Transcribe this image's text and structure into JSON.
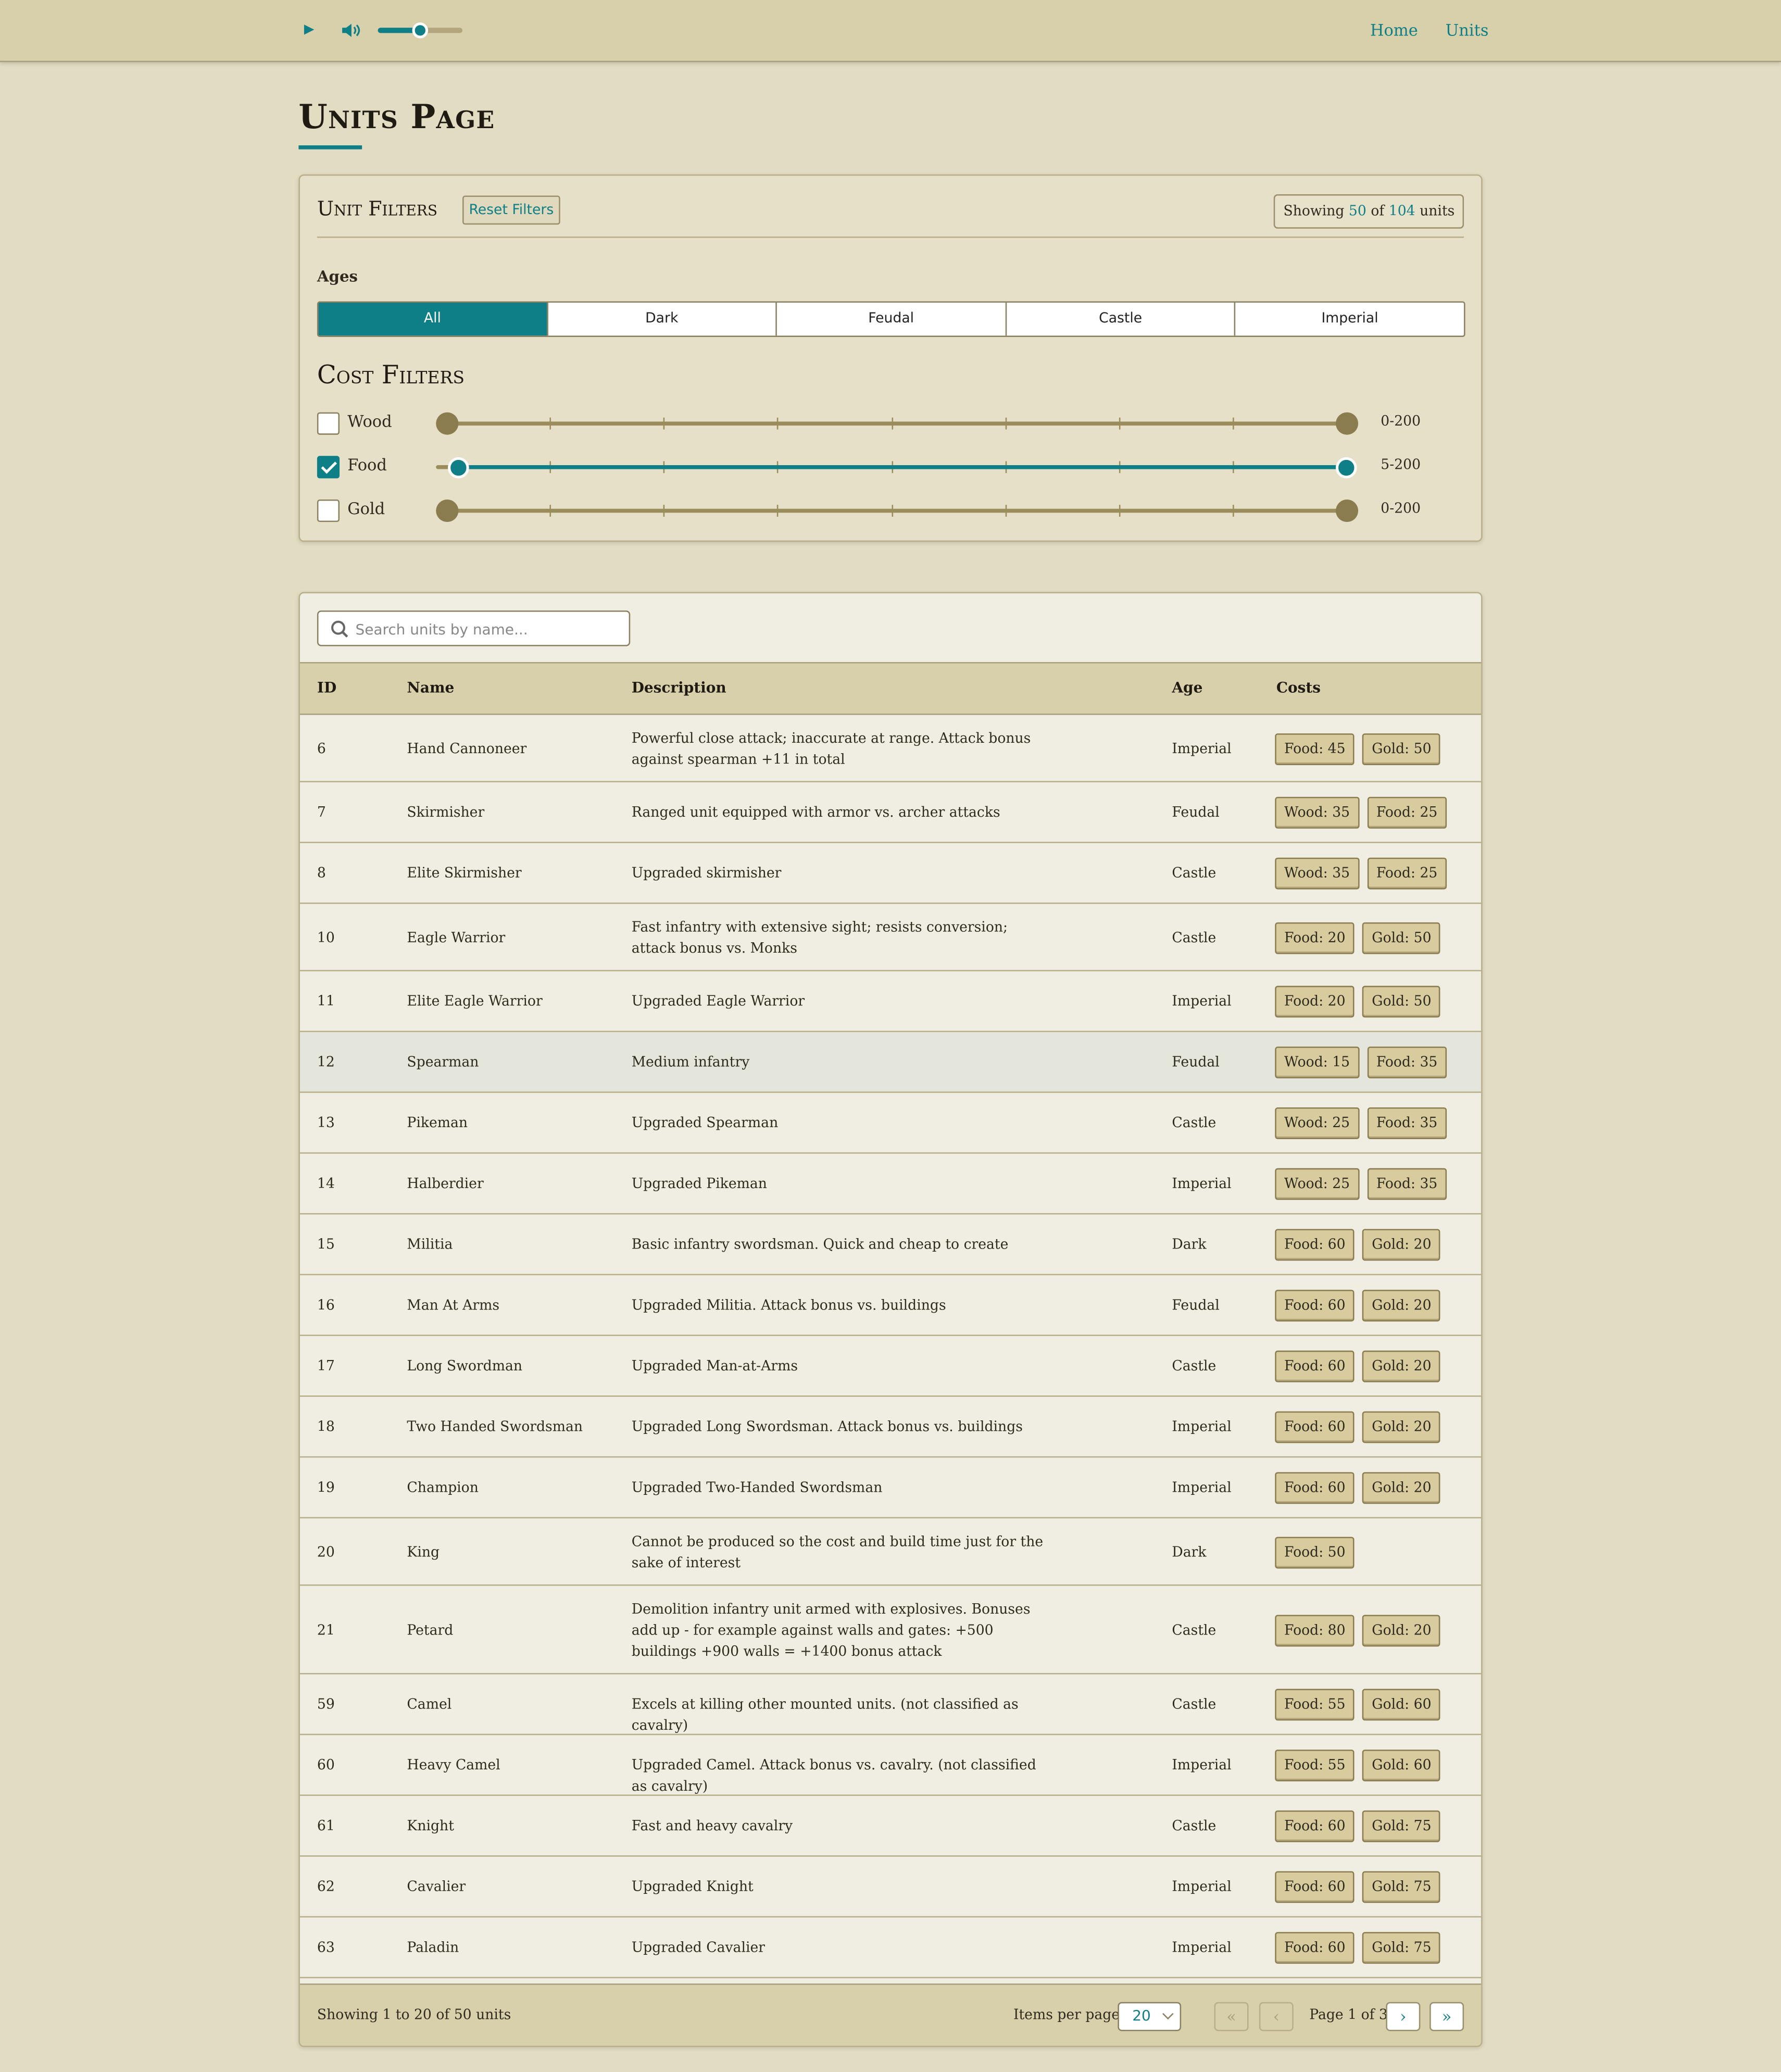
{
  "player": {
    "play_icon": "play-icon",
    "volume_icon": "speaker-icon",
    "volume_level": 0.5
  },
  "nav": {
    "home": "Home",
    "units": "Units"
  },
  "page_title": "Units Page",
  "filters": {
    "title": "Unit Filters",
    "reset_label": "Reset Filters",
    "showing": {
      "prefix": "Showing",
      "shown": "50",
      "of": "of",
      "total": "104",
      "suffix": "units"
    },
    "ages_label": "Ages",
    "ages": [
      "All",
      "Dark",
      "Feudal",
      "Castle",
      "Imperial"
    ],
    "active_age": "All",
    "cost_title": "Cost Filters",
    "costs": [
      {
        "label": "Wood",
        "checked": false,
        "min": 0,
        "max": 200,
        "range_text": "0-200"
      },
      {
        "label": "Food",
        "checked": true,
        "min": 5,
        "max": 200,
        "range_text": "5-200"
      },
      {
        "label": "Gold",
        "checked": false,
        "min": 0,
        "max": 200,
        "range_text": "0-200"
      }
    ]
  },
  "table": {
    "search_placeholder": "Search units by name...",
    "search_icon": "search-icon",
    "columns": [
      "ID",
      "Name",
      "Description",
      "Age",
      "Costs"
    ],
    "rows": [
      {
        "id": "6",
        "name": "Hand Cannoneer",
        "desc": "Powerful close attack; inaccurate at range. Attack bonus against spearman +11 in total",
        "age": "Imperial",
        "costs": [
          "Food: 45",
          "Gold: 50"
        ]
      },
      {
        "id": "7",
        "name": "Skirmisher",
        "desc": "Ranged unit equipped with armor vs. archer attacks",
        "age": "Feudal",
        "costs": [
          "Wood: 35",
          "Food: 25"
        ]
      },
      {
        "id": "8",
        "name": "Elite Skirmisher",
        "desc": "Upgraded skirmisher",
        "age": "Castle",
        "costs": [
          "Wood: 35",
          "Food: 25"
        ]
      },
      {
        "id": "10",
        "name": "Eagle Warrior",
        "desc": "Fast infantry with extensive sight; resists conversion; attack bonus vs. Monks",
        "age": "Castle",
        "costs": [
          "Food: 20",
          "Gold: 50"
        ]
      },
      {
        "id": "11",
        "name": "Elite Eagle Warrior",
        "desc": "Upgraded Eagle Warrior",
        "age": "Imperial",
        "costs": [
          "Food: 20",
          "Gold: 50"
        ]
      },
      {
        "id": "12",
        "name": "Spearman",
        "desc": "Medium infantry",
        "age": "Feudal",
        "costs": [
          "Wood: 15",
          "Food: 35"
        ]
      },
      {
        "id": "13",
        "name": "Pikeman",
        "desc": "Upgraded Spearman",
        "age": "Castle",
        "costs": [
          "Wood: 25",
          "Food: 35"
        ]
      },
      {
        "id": "14",
        "name": "Halberdier",
        "desc": "Upgraded Pikeman",
        "age": "Imperial",
        "costs": [
          "Wood: 25",
          "Food: 35"
        ]
      },
      {
        "id": "15",
        "name": "Militia",
        "desc": "Basic infantry swordsman. Quick and cheap to create",
        "age": "Dark",
        "costs": [
          "Food: 60",
          "Gold: 20"
        ]
      },
      {
        "id": "16",
        "name": "Man At Arms",
        "desc": "Upgraded Militia. Attack bonus vs. buildings",
        "age": "Feudal",
        "costs": [
          "Food: 60",
          "Gold: 20"
        ]
      },
      {
        "id": "17",
        "name": "Long Swordman",
        "desc": "Upgraded Man-at-Arms",
        "age": "Castle",
        "costs": [
          "Food: 60",
          "Gold: 20"
        ]
      },
      {
        "id": "18",
        "name": "Two Handed Swordsman",
        "desc": "Upgraded Long Swordsman. Attack bonus vs. buildings",
        "age": "Imperial",
        "costs": [
          "Food: 60",
          "Gold: 20"
        ]
      },
      {
        "id": "19",
        "name": "Champion",
        "desc": "Upgraded Two-Handed Swordsman",
        "age": "Imperial",
        "costs": [
          "Food: 60",
          "Gold: 20"
        ]
      },
      {
        "id": "20",
        "name": "King",
        "desc": "Cannot be produced so the cost and build time just for the sake of interest",
        "age": "Dark",
        "costs": [
          "Food: 50"
        ]
      },
      {
        "id": "21",
        "name": "Petard",
        "desc": "Demolition infantry unit armed with explosives. Bonuses add up - for example against walls and gates: +500 buildings +900 walls = +1400 bonus attack",
        "age": "Castle",
        "costs": [
          "Food: 80",
          "Gold: 20"
        ]
      },
      {
        "id": "59",
        "name": "Camel",
        "desc": "Excels at killing other mounted units. (not classified as cavalry)",
        "age": "Castle",
        "costs": [
          "Food: 55",
          "Gold: 60"
        ]
      },
      {
        "id": "60",
        "name": "Heavy Camel",
        "desc": "Upgraded Camel. Attack bonus vs. cavalry. (not classified as cavalry)",
        "age": "Imperial",
        "costs": [
          "Food: 55",
          "Gold: 60"
        ]
      },
      {
        "id": "61",
        "name": "Knight",
        "desc": "Fast and heavy cavalry",
        "age": "Castle",
        "costs": [
          "Food: 60",
          "Gold: 75"
        ]
      },
      {
        "id": "62",
        "name": "Cavalier",
        "desc": "Upgraded Knight",
        "age": "Imperial",
        "costs": [
          "Food: 60",
          "Gold: 75"
        ]
      },
      {
        "id": "63",
        "name": "Paladin",
        "desc": "Upgraded Cavalier",
        "age": "Imperial",
        "costs": [
          "Food: 60",
          "Gold: 75"
        ]
      }
    ],
    "hovered_row": "12"
  },
  "footer": {
    "showing_text": "Showing 1 to 20 of 50 units",
    "items_per_page_label": "Items per page:",
    "items_per_page": "20",
    "first": "«",
    "prev": "‹",
    "page_info": "Page 1 of 3",
    "next": "›",
    "last": "»"
  }
}
